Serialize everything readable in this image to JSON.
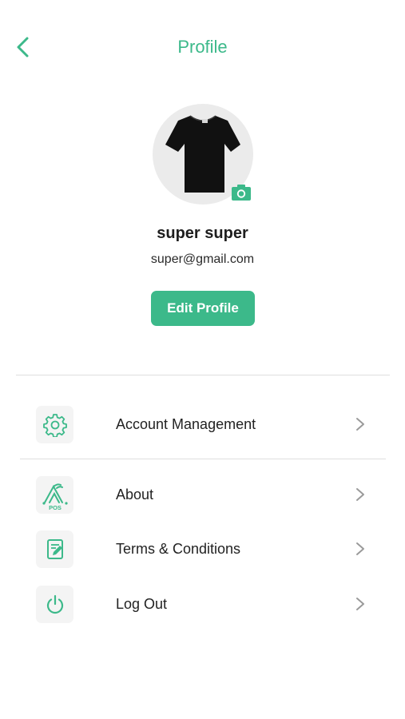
{
  "header": {
    "title": "Profile",
    "back_icon": "chevron-left-icon"
  },
  "profile": {
    "avatar_icon": "tshirt-icon",
    "camera_icon": "camera-icon",
    "name": "super super",
    "email": "super@gmail.com",
    "edit_label": "Edit Profile"
  },
  "menu": {
    "items": [
      {
        "label": "Account Management",
        "icon": "gear-icon"
      },
      {
        "label": "About",
        "icon": "pos-logo-icon",
        "logo_text": "POS"
      },
      {
        "label": "Terms & Conditions",
        "icon": "document-edit-icon"
      },
      {
        "label": "Log Out",
        "icon": "power-icon"
      }
    ]
  },
  "colors": {
    "accent": "#3cb98a",
    "background": "#ffffff",
    "icon_tile": "#f4f4f4",
    "avatar_bg": "#ebebeb",
    "divider": "#dedede",
    "text": "#222222",
    "chevron": "#9a9a9a"
  }
}
